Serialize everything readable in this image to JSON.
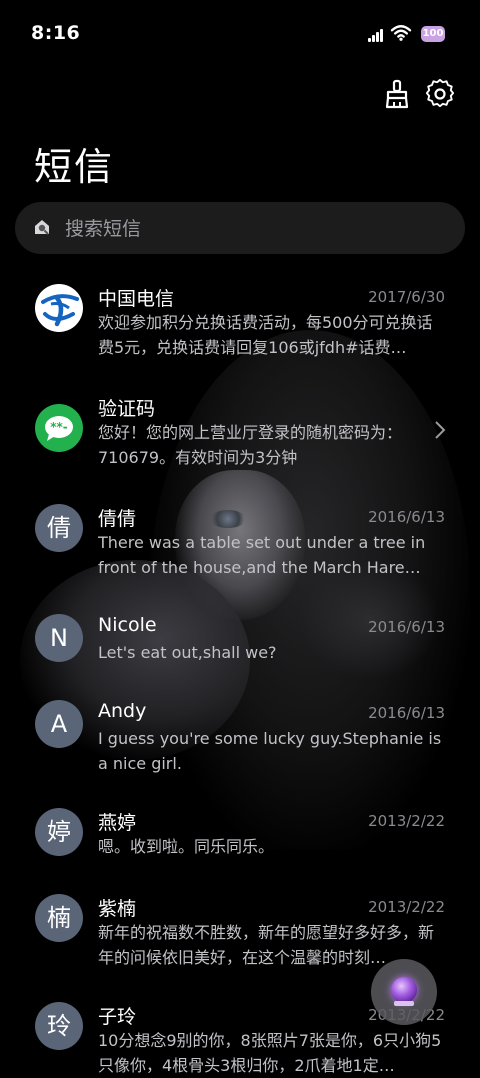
{
  "status": {
    "time": "8:16",
    "battery": "100"
  },
  "header": {
    "title": "短信"
  },
  "search": {
    "placeholder": "搜索短信"
  },
  "messages": [
    {
      "name": "中国电信",
      "date": "2017/6/30",
      "preview": "欢迎参加积分兑换话费活动，每500分可兑换话费5元，兑换话费请回复106或jfdh#话费…",
      "avatar": ""
    },
    {
      "name": "验证码",
      "date": "",
      "preview": "您好！您的网上营业厅登录的随机密码为：710679。有效时间为3分钟",
      "avatar": ""
    },
    {
      "name": "倩倩",
      "date": "2016/6/13",
      "preview": "There was a table set out under a tree in front of the house,and the March Hare an…",
      "avatar": "倩"
    },
    {
      "name": "Nicole",
      "date": "2016/6/13",
      "preview": "Let's eat out,shall we?",
      "avatar": "N"
    },
    {
      "name": "Andy",
      "date": "2016/6/13",
      "preview": "I guess you're some lucky guy.Stephanie is a nice girl.",
      "avatar": "A"
    },
    {
      "name": "燕婷",
      "date": "2013/2/22",
      "preview": "嗯。收到啦。同乐同乐。",
      "avatar": "婷"
    },
    {
      "name": "紫楠",
      "date": "2013/2/22",
      "preview": "新年的祝福数不胜数，新年的愿望好多好多，新年的问候依旧美好，在这个温馨的时刻…",
      "avatar": "楠"
    },
    {
      "name": "子玲",
      "date": "2013/2/22",
      "preview": "10分想念9别的你，8张照片7张是你，6只小狗5只像你，4根骨头3根归你，2爪着地1定…",
      "avatar": "玲"
    }
  ],
  "colors": {
    "accent": "#22b14c",
    "avatar_bg": "#5a6577",
    "telecom_blue": "#1565c0",
    "battery": "#caa3e4"
  }
}
